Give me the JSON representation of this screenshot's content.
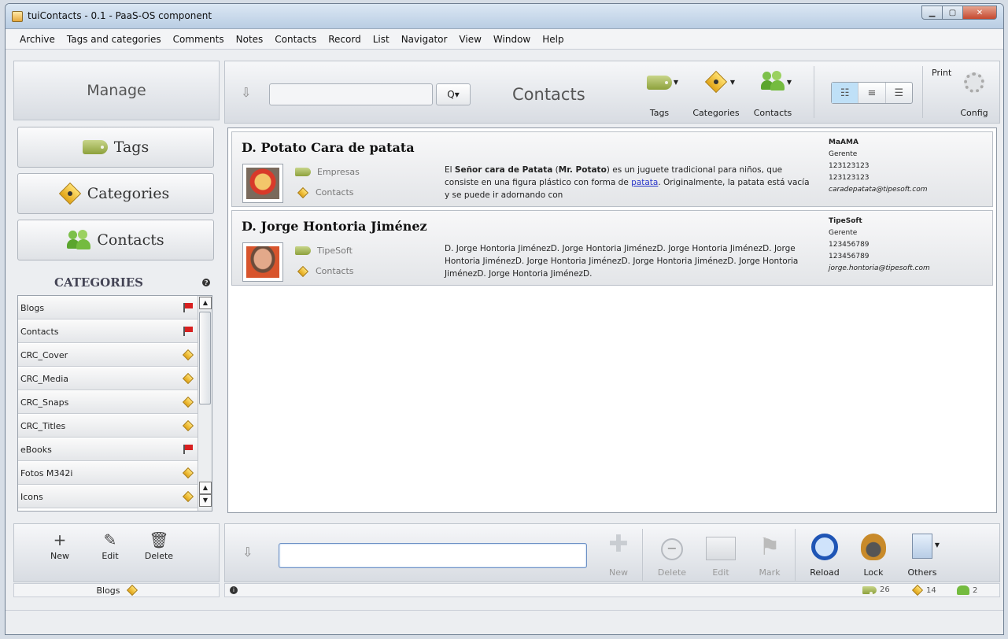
{
  "window": {
    "title": "tuiContacts - 0.1 - PaaS-OS component"
  },
  "menu": [
    "Archive",
    "Tags and categories",
    "Comments",
    "Notes",
    "Contacts",
    "Record",
    "List",
    "Navigator",
    "View",
    "Window",
    "Help"
  ],
  "left": {
    "manage_label": "Manage",
    "nav": {
      "tags": "Tags",
      "categories": "Categories",
      "contacts": "Contacts"
    },
    "categories_header": "CATEGORIES",
    "categories": [
      {
        "label": "Blogs",
        "marker": "flag-icon"
      },
      {
        "label": "Contacts",
        "marker": "flag-icon"
      },
      {
        "label": "CRC_Cover",
        "marker": "category-icon"
      },
      {
        "label": "CRC_Media",
        "marker": "category-icon"
      },
      {
        "label": "CRC_Snaps",
        "marker": "category-icon"
      },
      {
        "label": "CRC_Titles",
        "marker": "category-icon"
      },
      {
        "label": "eBooks",
        "marker": "flag-icon"
      },
      {
        "label": "Fotos M342i",
        "marker": "category-icon"
      },
      {
        "label": "Icons",
        "marker": "category-icon"
      }
    ],
    "tools": {
      "new": "New",
      "edit": "Edit",
      "delete": "Delete"
    },
    "status": "Blogs"
  },
  "toolbar": {
    "search_value": "",
    "search_btn": "Q▾",
    "title": "Contacts",
    "tags": "Tags",
    "categories": "Categories",
    "contacts": "Contacts",
    "print": "Print",
    "config": "Config"
  },
  "contacts": [
    {
      "name": "D. Potato Cara de patata",
      "tag": "Empresas",
      "category": "Contacts",
      "desc_pre": "El ",
      "desc_bold1": "Señor cara de Patata",
      "desc_mid1": " (",
      "desc_bold2": "Mr. Potato",
      "desc_mid2": ") es un juguete tradicional para niños, que consiste en una figura plástico con forma de ",
      "desc_link": "patata",
      "desc_post": ". Originalmente, la patata está  vacía y se puede ir adornando con",
      "company": "MaAMA",
      "role": "Gerente",
      "phone1": "123123123",
      "phone2": "123123123",
      "email": "caradepatata@tipesoft.com"
    },
    {
      "name": "D. Jorge Hontoria Jiménez",
      "tag": "TipeSoft",
      "category": "Contacts",
      "desc": "D. Jorge Hontoria JiménezD. Jorge Hontoria JiménezD. Jorge Hontoria JiménezD. Jorge Hontoria JiménezD. Jorge Hontoria JiménezD. Jorge Hontoria JiménezD. Jorge Hontoria JiménezD. Jorge Hontoria JiménezD.",
      "company": "TipeSoft",
      "role": "Gerente",
      "phone1": "123456789",
      "phone2": "123456789",
      "email": "jorge.hontoria@tipesoft.com"
    }
  ],
  "bottom": {
    "input_value": "",
    "new": "New",
    "delete": "Delete",
    "edit": "Edit",
    "mark": "Mark",
    "reload": "Reload",
    "lock": "Lock",
    "others": "Others"
  },
  "status_counts": {
    "tags": "26",
    "categories": "14",
    "contacts": "2"
  }
}
